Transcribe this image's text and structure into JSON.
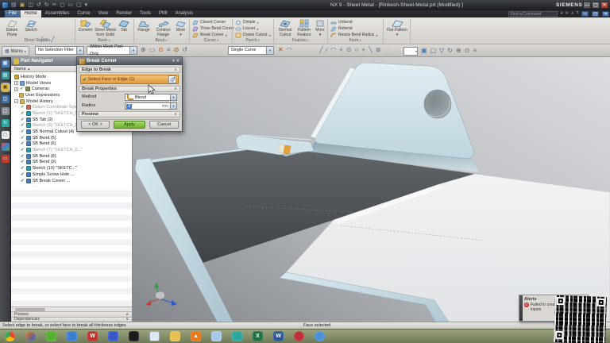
{
  "window": {
    "title": "NX 9 - Sheet Metal - [Rinkesh-Sheet-Metal.prt (Modified) ]",
    "brand": "SIEMENS"
  },
  "quick_access": {
    "icons": [
      "new",
      "open",
      "save",
      "undo",
      "redo",
      "cut",
      "copy",
      "paste",
      "window-style",
      "touch-mode"
    ]
  },
  "tabs": {
    "items": [
      "File",
      "Home",
      "Assemblies",
      "Curve",
      "View",
      "Render",
      "Tools",
      "PMI",
      "Analysis"
    ],
    "active": "Home",
    "find_command": "Find a Command"
  },
  "ribbon": {
    "groups": [
      {
        "label": "Direct Sketch",
        "items": [
          "Datum Plane",
          "Sketch"
        ]
      },
      {
        "label": "Basic",
        "items": [
          "Convert",
          "Sheet Metal from Solid",
          "Tab"
        ]
      },
      {
        "label": "Bend",
        "items": [
          "Flange",
          "Contour Flange",
          "More"
        ]
      },
      {
        "label": "Corner",
        "items": [
          "Closed Corner",
          "Three Bend Corner",
          "Break Corner"
        ]
      },
      {
        "label": "Punch",
        "items": [
          "Dimple",
          "Louver",
          "Drawn Cutout"
        ]
      },
      {
        "label": "Feature",
        "items": [
          "Normal Cutout",
          "Pattern Feature",
          "More"
        ]
      },
      {
        "label": "Form",
        "items": [
          "Unbend",
          "Rebend",
          "Resize Bend Radius"
        ]
      },
      {
        "label": "Flat Pattern",
        "items": [
          "Flat Pattern"
        ]
      }
    ]
  },
  "toolbar": {
    "menu": "Menu",
    "selection_filter": "No Selection Filter",
    "scope": "Within Work Part Only",
    "curve_rule": "Single Curve",
    "icons": [
      "select-tools",
      "snap-point",
      "view-style",
      "shaded-view",
      "orient-view"
    ]
  },
  "sidebar": {
    "icons": [
      "assembly-navigator",
      "constraint-navigator",
      "part-navigator",
      "reuse-library",
      "view-palette",
      "history",
      "web-browser",
      "roles",
      "process-studio"
    ]
  },
  "part_navigator": {
    "title": "Part Navigator",
    "column": "Name",
    "items": [
      {
        "label": "History Mode"
      },
      {
        "label": "Model Views"
      },
      {
        "label": "Cameras",
        "checked": true
      },
      {
        "label": "User Expressions"
      },
      {
        "label": "Model History"
      },
      {
        "label": "Datum Coordinate Syst...",
        "checked": true
      },
      {
        "label": "Sketch (1) \"SKETCH_0...\"",
        "checked": true
      },
      {
        "label": "SB Tab (2)",
        "checked": true
      },
      {
        "label": "Sketch (3) \"SKETCH_0...\"",
        "checked": true
      },
      {
        "label": "SB Normal Cutout (4)",
        "checked": true
      },
      {
        "label": "SB Bend (5)",
        "checked": true
      },
      {
        "label": "SB Bend (6)",
        "checked": true
      },
      {
        "label": "Sketch (7) \"SKETCH_0...\"",
        "checked": true
      },
      {
        "label": "SB Bend (8)",
        "checked": true
      },
      {
        "label": "SB Bend (9)",
        "checked": true
      },
      {
        "label": "Sketch (10) \"SKETC...\"",
        "checked": true
      },
      {
        "label": "Simple Screw Hole ...",
        "checked": true
      },
      {
        "label": "SB Break Corner ...",
        "checked": true
      }
    ],
    "sections": {
      "preview": "Preview",
      "dependencies": "Dependencies"
    }
  },
  "dialog": {
    "title": "Break Corner",
    "edge_section": "Edge to Break",
    "select_row": "Select Face or Edge (1)",
    "props_section": "Break Properties",
    "method_label": "Method",
    "method_value": "Blend",
    "radius_label": "Radius",
    "radius_value": "3",
    "radius_unit": "mm",
    "preview_section": "Preview",
    "buttons": {
      "ok": "< OK >",
      "apply": "Apply",
      "cancel": "Cancel"
    }
  },
  "alerts": {
    "title": "Alerts",
    "message_line1": "Failed to crea",
    "message_line2": "inputs"
  },
  "status_bar": {
    "prompt": "Select edge to break, or select face to break all thickness edges",
    "selection": "Face selected"
  },
  "taskbar": {
    "icons": [
      "chrome",
      "firefox",
      "green-app",
      "folder-blue",
      "red-office",
      "media-app",
      "photo-viewer",
      "document",
      "folder-yellow",
      "vlc",
      "document-blue",
      "teal-app",
      "excel",
      "word",
      "red-app",
      "blue-app"
    ]
  },
  "colors": {
    "selection_orange": "#e09a3c",
    "apply_green": "#71b02c",
    "part_blue": "#cfe2ea",
    "part_dark_face": "#4b5054",
    "highlight_edge": "#e6a13e"
  }
}
